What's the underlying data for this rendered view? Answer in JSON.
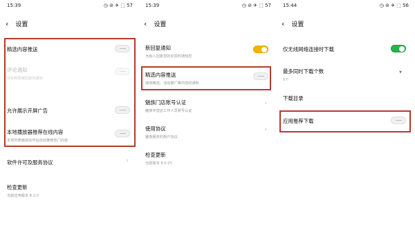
{
  "screen1": {
    "status": {
      "time": "15:39",
      "icons": "◷ ⊘ ✈ ⬚ 57"
    },
    "title": "设置",
    "items": [
      {
        "label": "精选内容推送"
      },
      {
        "label": "评论通知",
        "sub": "评论和赞被回复时通知"
      },
      {
        "label": "允许展示开屏广告"
      },
      {
        "label": "本地播放器推荐在线内容",
        "sub": "本地列表播放完毕后自动推荐热门内容"
      },
      {
        "label": "软件许可及服务协议"
      },
      {
        "label": "检查更新",
        "sub": "当前应用版本 8.2.0"
      }
    ]
  },
  "screen2": {
    "status": {
      "time": "15:39",
      "icons": "◷ ⊘ ✈ ⬚ 57"
    },
    "title": "设置",
    "items": [
      {
        "label": "新回复通知",
        "sub": "当有人回复您的反馈时通知您"
      },
      {
        "label": "精选内容推送",
        "sub": "接收精选、活动推广等内容的通知"
      },
      {
        "label": "魅族门店账号认证",
        "sub": "魅族专营店工作人员账号认证"
      },
      {
        "label": "使用协议",
        "sub": "魅族服务的用户协议"
      },
      {
        "label": "检查更新",
        "sub": "当前版本 8.0.25"
      }
    ]
  },
  "screen3": {
    "status": {
      "time": "15:44",
      "icons": "◷ ⊘ ✈ ⬚ 56"
    },
    "title": "设置",
    "items": [
      {
        "label": "仅无线网络连接时下载"
      },
      {
        "label": "最多同时下载个数",
        "sub": "5个"
      },
      {
        "label": "下载目录"
      },
      {
        "label": "应用推荐下载"
      }
    ]
  },
  "icons": {
    "back": "‹",
    "chevron": "›",
    "caret": "▼"
  },
  "colors": {
    "highlight": "#b23a2e",
    "toggle_on_yellow": "#f3b300",
    "toggle_on_green": "#27b34d"
  }
}
